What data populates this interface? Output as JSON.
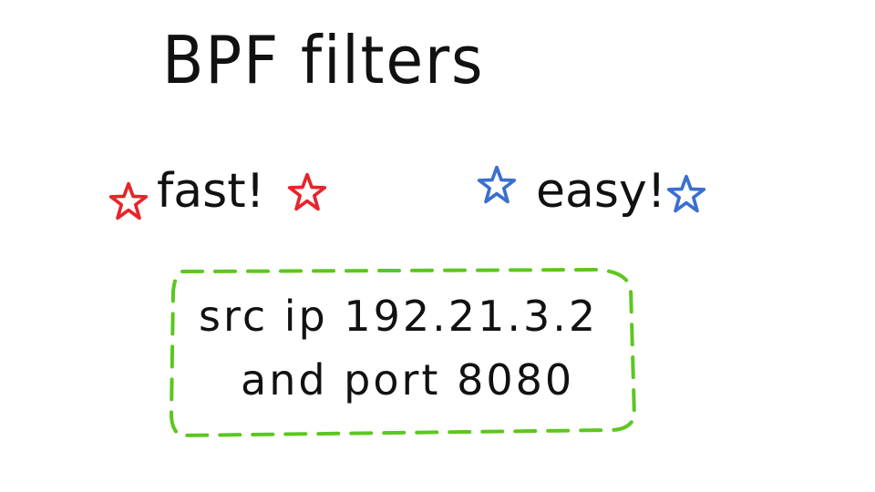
{
  "title": "BPF filters",
  "features": [
    {
      "label": "fast!",
      "color": "#e8242b"
    },
    {
      "label": "easy!",
      "color": "#3a6fd0"
    }
  ],
  "filter_example": {
    "line1": "src ip 192.21.3.2",
    "line2": "and port 8080",
    "border_color": "#5cc71e"
  },
  "icons": {
    "feature_marker": "star-icon"
  }
}
